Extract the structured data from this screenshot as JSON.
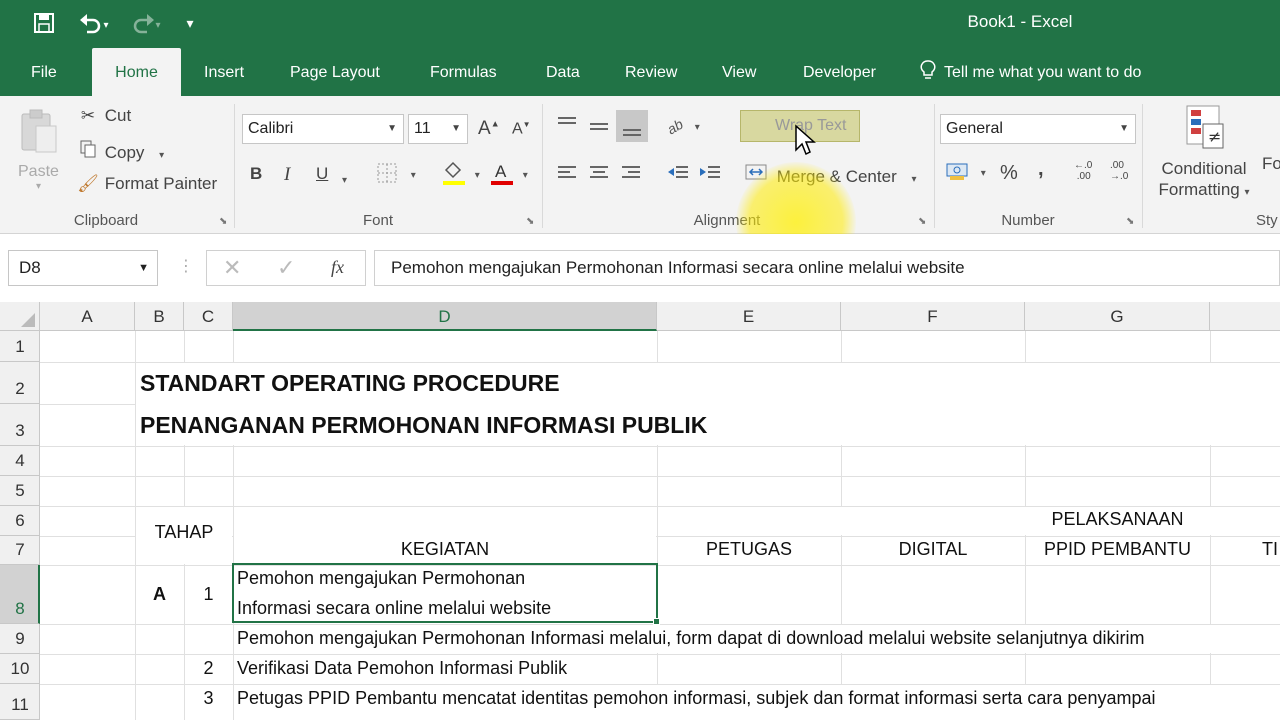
{
  "window": {
    "title": "Book1  -  Excel"
  },
  "qat": {
    "save_icon": "save-icon",
    "undo_icon": "undo-icon",
    "redo_icon": "redo-icon",
    "customize_icon": "customize-qat-icon"
  },
  "tabs": [
    {
      "label": "File"
    },
    {
      "label": "Home",
      "active": true
    },
    {
      "label": "Insert"
    },
    {
      "label": "Page Layout"
    },
    {
      "label": "Formulas"
    },
    {
      "label": "Data"
    },
    {
      "label": "Review"
    },
    {
      "label": "View"
    },
    {
      "label": "Developer"
    }
  ],
  "tell_me": "Tell me what you want to do",
  "ribbon": {
    "clipboard": {
      "paste": "Paste",
      "cut": "Cut",
      "copy": "Copy",
      "format_painter": "Format Painter",
      "label": "Clipboard"
    },
    "font": {
      "name": "Calibri",
      "size": "11",
      "bold": "B",
      "italic": "I",
      "underline": "U",
      "label": "Font"
    },
    "alignment": {
      "wrap_text": "Wrap Text",
      "merge_center": "Merge & Center",
      "label": "Alignment"
    },
    "number": {
      "format": "General",
      "percent": "%",
      "comma": ",",
      "label": "Number"
    },
    "styles": {
      "conditional": "Conditional",
      "formatting": "Formatting",
      "next_partial": "Fo",
      "label": "Sty"
    }
  },
  "formula_bar": {
    "name_box": "D8",
    "fx": "fx",
    "value": "Pemohon mengajukan Permohonan Informasi secara online melalui website"
  },
  "columns": [
    "A",
    "B",
    "C",
    "D",
    "E",
    "F",
    "G"
  ],
  "rows": [
    "1",
    "2",
    "3",
    "4",
    "5",
    "6",
    "7",
    "8",
    "9",
    "10",
    "11"
  ],
  "cells": {
    "B2": "STANDART OPERATING PROCEDURE",
    "B3": "PENANGANAN PERMOHONAN INFORMASI PUBLIK",
    "B6": "TAHAP",
    "D7": "KEGIATAN",
    "G6": "PELAKSANAAN",
    "E7": "PETUGAS",
    "F7": "DIGITAL",
    "G7": "PPID PEMBANTU",
    "H7": "TI",
    "B8": "A",
    "C8": "1",
    "D8_line1": "Pemohon mengajukan Permohonan",
    "D8_line2": "Informasi secara online melalui website",
    "D9": "Pemohon mengajukan Permohonan Informasi melalui, form dapat di download melalui website selanjutnya dikirim",
    "C10": "2",
    "D10": "Verifikasi Data Pemohon Informasi Publik",
    "C11": "3",
    "D11": "Petugas PPID Pembantu mencatat identitas pemohon informasi, subjek dan format informasi serta cara penyampai"
  },
  "colors": {
    "brand": "#217346",
    "highlight": "#ffeb00"
  }
}
